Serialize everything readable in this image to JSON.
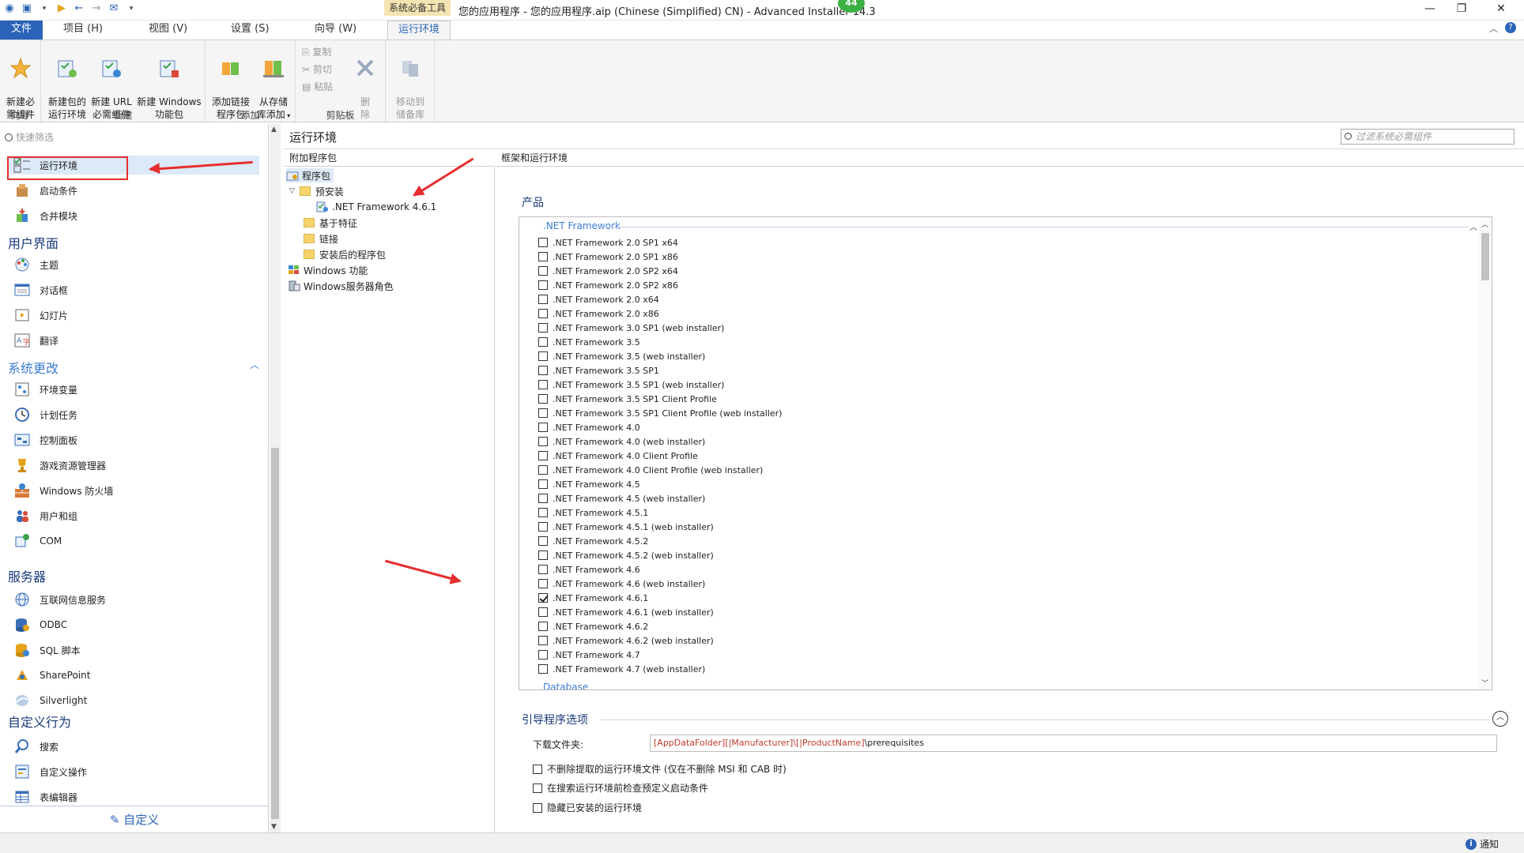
{
  "window": {
    "title": "您的应用程序 - 您的应用程序.aip (Chinese (Simplified) CN) - Advanced Installer 14.3",
    "context_group": "系统必备工具",
    "badge": "44"
  },
  "tabs": {
    "file": "文件",
    "project": "项目 (H)",
    "view": "视图 (V)",
    "settings": "设置 (S)",
    "wizard": "向导 (W)",
    "active": "运行环境"
  },
  "ribbon": {
    "new_required": "新建必\n需组件",
    "new_pkg_runtime": "新建包的\n运行环境",
    "new_url_required": "新建 URL\n必需组件",
    "new_windows_feature": "新建 Windows\n功能包",
    "add_linked_pkg": "添加链接\n程序包",
    "add_from_repo": "从存储\n库添加",
    "copy": "复制",
    "cut": "剪切",
    "paste": "粘贴",
    "delete": "删\n除",
    "move_to_repo": "移动到\n储备库",
    "group_wizard": "向导",
    "group_new": "新建",
    "group_add": "添加",
    "group_clipboard": "剪贴板"
  },
  "left": {
    "filter_placeholder": "快速筛选",
    "items": [
      {
        "label": "运行环境"
      },
      {
        "label": "启动条件"
      },
      {
        "label": "合并模块"
      }
    ],
    "section_ui": "用户界面",
    "ui_items": [
      {
        "label": "主题"
      },
      {
        "label": "对话框"
      },
      {
        "label": "幻灯片"
      },
      {
        "label": "翻译"
      }
    ],
    "section_sys": "系统更改",
    "sys_items": [
      {
        "label": "环境变量"
      },
      {
        "label": "计划任务"
      },
      {
        "label": "控制面板"
      },
      {
        "label": "游戏资源管理器"
      },
      {
        "label": "Windows 防火墙"
      },
      {
        "label": "用户和组"
      },
      {
        "label": "COM"
      }
    ],
    "section_server": "服务器",
    "server_items": [
      {
        "label": "互联网信息服务"
      },
      {
        "label": "ODBC"
      },
      {
        "label": "SQL 脚本"
      },
      {
        "label": "SharePoint"
      },
      {
        "label": "Silverlight"
      }
    ],
    "section_custom": "自定义行为",
    "custom_items": [
      {
        "label": "搜索"
      },
      {
        "label": "自定义操作"
      },
      {
        "label": "表编辑器"
      }
    ],
    "customize": "自定义"
  },
  "main": {
    "header": "运行环境",
    "search_placeholder": "过滤系统必需组件"
  },
  "tree": {
    "header": "附加程序包",
    "nodes": [
      {
        "label": "程序包"
      },
      {
        "label": "预安装"
      },
      {
        "label": ".NET Framework 4.6.1"
      },
      {
        "label": "基于特征"
      },
      {
        "label": "链接"
      },
      {
        "label": "安装后的程序包"
      },
      {
        "label": "Windows 功能"
      },
      {
        "label": "Windows服务器角色"
      }
    ]
  },
  "right": {
    "header": "框架和运行环境",
    "products_title": "产品",
    "category": ".NET Framework",
    "next_category": "Database",
    "products": [
      {
        "label": ".NET Framework 2.0 SP1 x64",
        "checked": false
      },
      {
        "label": ".NET Framework 2.0 SP1 x86",
        "checked": false
      },
      {
        "label": ".NET Framework 2.0 SP2 x64",
        "checked": false
      },
      {
        "label": ".NET Framework 2.0 SP2 x86",
        "checked": false
      },
      {
        "label": ".NET Framework 2.0 x64",
        "checked": false
      },
      {
        "label": ".NET Framework 2.0 x86",
        "checked": false
      },
      {
        "label": ".NET Framework 3.0 SP1 (web installer)",
        "checked": false
      },
      {
        "label": ".NET Framework 3.5",
        "checked": false
      },
      {
        "label": ".NET Framework 3.5 (web installer)",
        "checked": false
      },
      {
        "label": ".NET Framework 3.5 SP1",
        "checked": false
      },
      {
        "label": ".NET Framework 3.5 SP1 (web installer)",
        "checked": false
      },
      {
        "label": ".NET Framework 3.5 SP1 Client Profile",
        "checked": false
      },
      {
        "label": ".NET Framework 3.5 SP1 Client Profile (web installer)",
        "checked": false
      },
      {
        "label": ".NET Framework 4.0",
        "checked": false
      },
      {
        "label": ".NET Framework 4.0 (web installer)",
        "checked": false
      },
      {
        "label": ".NET Framework 4.0 Client Profile",
        "checked": false
      },
      {
        "label": ".NET Framework 4.0 Client Profile (web installer)",
        "checked": false
      },
      {
        "label": ".NET Framework 4.5",
        "checked": false
      },
      {
        "label": ".NET Framework 4.5 (web installer)",
        "checked": false
      },
      {
        "label": ".NET Framework 4.5.1",
        "checked": false
      },
      {
        "label": ".NET Framework 4.5.1 (web installer)",
        "checked": false
      },
      {
        "label": ".NET Framework 4.5.2",
        "checked": false
      },
      {
        "label": ".NET Framework 4.5.2 (web installer)",
        "checked": false
      },
      {
        "label": ".NET Framework 4.6",
        "checked": false
      },
      {
        "label": ".NET Framework 4.6 (web installer)",
        "checked": false
      },
      {
        "label": ".NET Framework 4.6.1",
        "checked": true
      },
      {
        "label": ".NET Framework 4.6.1 (web installer)",
        "checked": false
      },
      {
        "label": ".NET Framework 4.6.2",
        "checked": false
      },
      {
        "label": ".NET Framework 4.6.2 (web installer)",
        "checked": false
      },
      {
        "label": ".NET Framework 4.7",
        "checked": false
      },
      {
        "label": ".NET Framework 4.7 (web installer)",
        "checked": false
      }
    ],
    "bootstrapper_title": "引导程序选项",
    "download_label": "下载文件夹:",
    "download_path_red": "[AppDataFolder][|Manufacturer]\\[|ProductName]",
    "download_path_rest": "\\prerequisites",
    "options": [
      {
        "label": "不删除提取的运行环境文件 (仅在不删除 MSI 和 CAB 时)",
        "checked": false
      },
      {
        "label": "在搜索运行环境前检查预定义启动条件",
        "checked": false
      },
      {
        "label": "隐藏已安装的运行环境",
        "checked": false
      }
    ]
  },
  "status": {
    "notify": "通知"
  },
  "colors": {
    "accent": "#2b63b8",
    "annotation_red": "#e62e2e",
    "context_tab": "#f3e4b2"
  }
}
